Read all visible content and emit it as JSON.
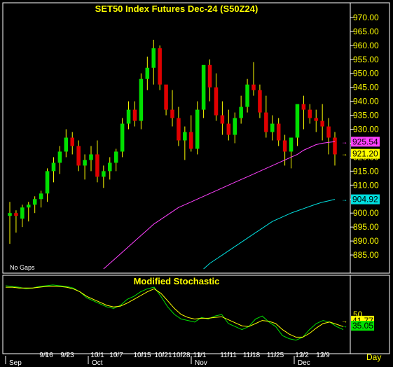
{
  "chart_data": [
    {
      "type": "candlestick",
      "title": "SET50  Index  Futures  Dec-24  (S50Z24)",
      "note": "No Gaps",
      "ylim": [
        879,
        975
      ],
      "y_ticks": [
        "970.00",
        "965.00",
        "960.00",
        "955.00",
        "950.00",
        "945.00",
        "940.00",
        "935.00",
        "930.00",
        "925.00",
        "920.00",
        "915.00",
        "910.00",
        "905.00",
        "900.00",
        "895.00",
        "890.00",
        "885.00"
      ],
      "grid": false,
      "up_color": "#00e000",
      "down_color": "#e00000",
      "candles": [
        [
          899,
          904,
          889,
          900
        ],
        [
          900,
          901,
          893,
          899
        ],
        [
          898,
          903,
          895,
          902
        ],
        [
          902,
          904,
          897,
          903
        ],
        [
          903,
          906,
          900,
          905
        ],
        [
          905,
          908,
          902,
          907
        ],
        [
          907,
          916,
          904,
          915
        ],
        [
          915,
          920,
          911,
          918
        ],
        [
          918,
          924,
          914,
          922
        ],
        [
          922,
          930,
          920,
          927
        ],
        [
          927,
          929,
          921,
          924
        ],
        [
          924,
          926,
          915,
          917
        ],
        [
          917,
          921,
          912,
          919
        ],
        [
          919,
          924,
          915,
          921
        ],
        [
          921,
          926,
          911,
          913
        ],
        [
          913,
          917,
          909,
          915
        ],
        [
          915,
          920,
          912,
          918
        ],
        [
          918,
          923,
          915,
          922
        ],
        [
          922,
          934,
          920,
          932
        ],
        [
          932,
          940,
          930,
          937
        ],
        [
          937,
          940,
          931,
          933
        ],
        [
          933,
          950,
          930,
          948
        ],
        [
          948,
          956,
          944,
          952
        ],
        [
          952,
          962,
          946,
          959
        ],
        [
          959,
          960,
          944,
          946
        ],
        [
          946,
          944,
          935,
          937
        ],
        [
          937,
          944,
          931,
          934
        ],
        [
          934,
          938,
          924,
          926
        ],
        [
          926,
          931,
          919,
          929
        ],
        [
          929,
          935,
          922,
          923
        ],
        [
          923,
          940,
          921,
          937
        ],
        [
          937,
          950,
          934,
          953
        ],
        [
          953,
          955,
          940,
          945
        ],
        [
          945,
          950,
          933,
          935
        ],
        [
          935,
          940,
          928,
          932
        ],
        [
          932,
          937,
          926,
          928
        ],
        [
          928,
          936,
          925,
          934
        ],
        [
          934,
          942,
          932,
          938
        ],
        [
          938,
          948,
          936,
          946
        ],
        [
          946,
          954,
          942,
          944
        ],
        [
          944,
          946,
          934,
          936
        ],
        [
          936,
          942,
          927,
          929
        ],
        [
          929,
          935,
          926,
          932
        ],
        [
          932,
          934,
          924,
          926
        ],
        [
          926,
          928,
          917,
          922
        ],
        [
          922,
          925,
          916,
          927
        ],
        [
          927,
          936,
          924,
          939
        ],
        [
          939,
          942,
          930,
          937
        ],
        [
          937,
          939,
          932,
          934
        ],
        [
          934,
          937,
          929,
          933
        ],
        [
          933,
          939,
          926,
          931
        ],
        [
          931,
          934,
          921,
          927
        ],
        [
          927,
          929,
          917,
          921
        ]
      ],
      "series": [
        {
          "name": "",
          "color": "#ff40ff",
          "values": [
            840,
            842,
            844,
            846,
            848,
            850,
            852,
            854,
            856,
            858,
            860,
            862,
            864,
            866,
            868,
            870,
            872,
            874,
            876,
            878,
            880,
            882,
            884,
            886,
            888,
            890,
            892,
            894,
            896,
            897.5,
            899,
            900.5,
            902,
            903,
            904,
            905,
            906,
            907,
            908,
            909,
            910,
            911,
            912,
            913,
            914,
            915,
            916,
            917,
            918,
            919,
            920,
            921,
            922.5,
            923.5,
            924.5,
            925,
            925.3,
            925.54
          ]
        },
        {
          "name": "",
          "color": "#00e0e0",
          "values": [
            850,
            852,
            854,
            856,
            858,
            860,
            862,
            864,
            866,
            868,
            870,
            872,
            874,
            876,
            878,
            880,
            882,
            883.5,
            885,
            886.5,
            888,
            889.5,
            891,
            892.5,
            894,
            895.5,
            897,
            898,
            899,
            900,
            900.8,
            901.6,
            902.4,
            903.2,
            903.9,
            904.4,
            904.92
          ]
        }
      ],
      "price_labels": [
        {
          "text": "925.54",
          "value": 925.54,
          "bg": "#ff40ff",
          "fg": "#000000"
        },
        {
          "text": "921.20",
          "value": 921.2,
          "bg": "#ffff00",
          "fg": "#000000"
        },
        {
          "text": "904.92",
          "value": 904.92,
          "bg": "#00e0e0",
          "fg": "#000000"
        }
      ]
    },
    {
      "type": "line",
      "title": "Modified  Stochastic",
      "ylim": [
        0,
        100
      ],
      "series": [
        {
          "name": "",
          "color": "#00e000",
          "values": [
            88,
            87,
            86,
            84,
            85,
            87,
            88,
            89,
            88,
            87,
            85,
            80,
            72,
            68,
            64,
            60,
            58,
            62,
            70,
            74,
            80,
            84,
            86,
            74,
            60,
            50,
            44,
            42,
            40,
            46,
            44,
            48,
            50,
            38,
            34,
            30,
            34,
            44,
            48,
            40,
            34,
            22,
            18,
            16,
            20,
            30,
            38,
            42,
            40,
            34,
            30
          ]
        },
        {
          "name": "",
          "color": "#ffff00",
          "values": [
            86,
            86,
            85,
            85,
            85,
            86,
            87,
            87,
            87,
            86,
            84,
            80,
            74,
            70,
            66,
            62,
            60,
            61,
            65,
            70,
            75,
            80,
            84,
            78,
            68,
            58,
            50,
            46,
            44,
            45,
            45,
            46,
            47,
            43,
            39,
            35,
            34,
            38,
            42,
            41,
            38,
            30,
            24,
            20,
            20,
            25,
            32,
            38,
            40,
            37,
            34
          ]
        }
      ],
      "value_labels": [
        {
          "text": "41.77",
          "value": 41.77,
          "bg": "#ffff00",
          "fg": "#000000"
        },
        {
          "text": "35.05",
          "value": 35.05,
          "bg": "#00e000",
          "fg": "#000000"
        }
      ],
      "partial_tick": "50"
    }
  ],
  "x_axis": {
    "day_ticks": [
      "9/16",
      "9/23",
      "10/1",
      "10/7",
      "10/15",
      "10/21",
      "10/28",
      "11/1",
      "11/11",
      "11/18",
      "11/25",
      "12/2",
      "12/9"
    ],
    "month_ticks": [
      "Sep",
      "Oct",
      "Nov",
      "Dec"
    ],
    "unit": "Day"
  }
}
